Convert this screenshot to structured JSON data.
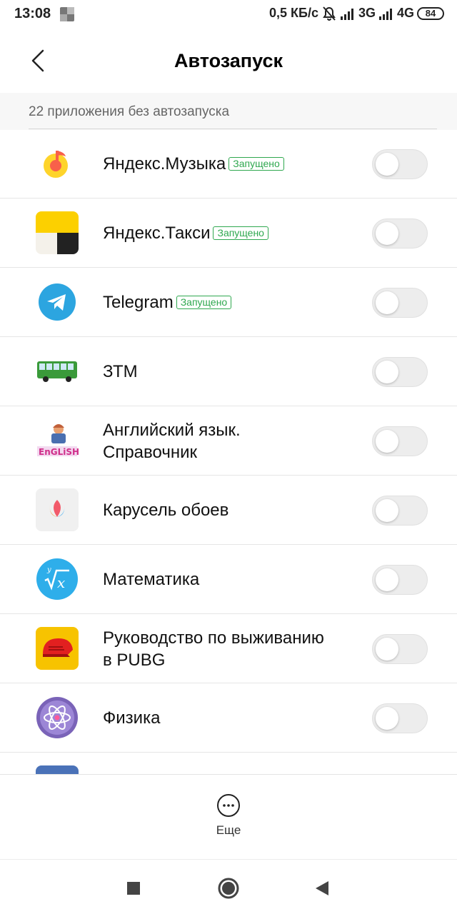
{
  "status_bar": {
    "time": "13:08",
    "network_speed": "0,5 КБ/с",
    "network_3g": "3G",
    "network_4g": "4G",
    "battery": "84"
  },
  "header": {
    "title": "Автозапуск"
  },
  "section": {
    "label": "22 приложения без автозапуска"
  },
  "apps": [
    {
      "name": "Яндекс.Музыка",
      "badge": "Запущено",
      "icon": "yandex-music-icon",
      "autostart": false
    },
    {
      "name": "Яндекс.Такси",
      "badge": "Запущено",
      "icon": "yandex-taxi-icon",
      "autostart": false
    },
    {
      "name": "Telegram",
      "badge": "Запущено",
      "icon": "telegram-icon",
      "autostart": false
    },
    {
      "name": "ЗТМ",
      "badge": "",
      "icon": "bus-icon",
      "autostart": false
    },
    {
      "name": "Английский язык.\nСправочник",
      "badge": "",
      "icon": "english-icon",
      "autostart": false
    },
    {
      "name": "Карусель обоев",
      "badge": "",
      "icon": "tulip-icon",
      "autostart": false
    },
    {
      "name": "Математика",
      "badge": "",
      "icon": "math-icon",
      "autostart": false
    },
    {
      "name": "Руководство по выживанию\nв PUBG",
      "badge": "",
      "icon": "pubg-helmet-icon",
      "autostart": false
    },
    {
      "name": "Физика",
      "badge": "",
      "icon": "atom-icon",
      "autostart": false
    }
  ],
  "bottom_bar": {
    "more_label": "Еще"
  },
  "colors": {
    "badge_green": "#2fa84f",
    "toggle_off": "#ededed"
  }
}
